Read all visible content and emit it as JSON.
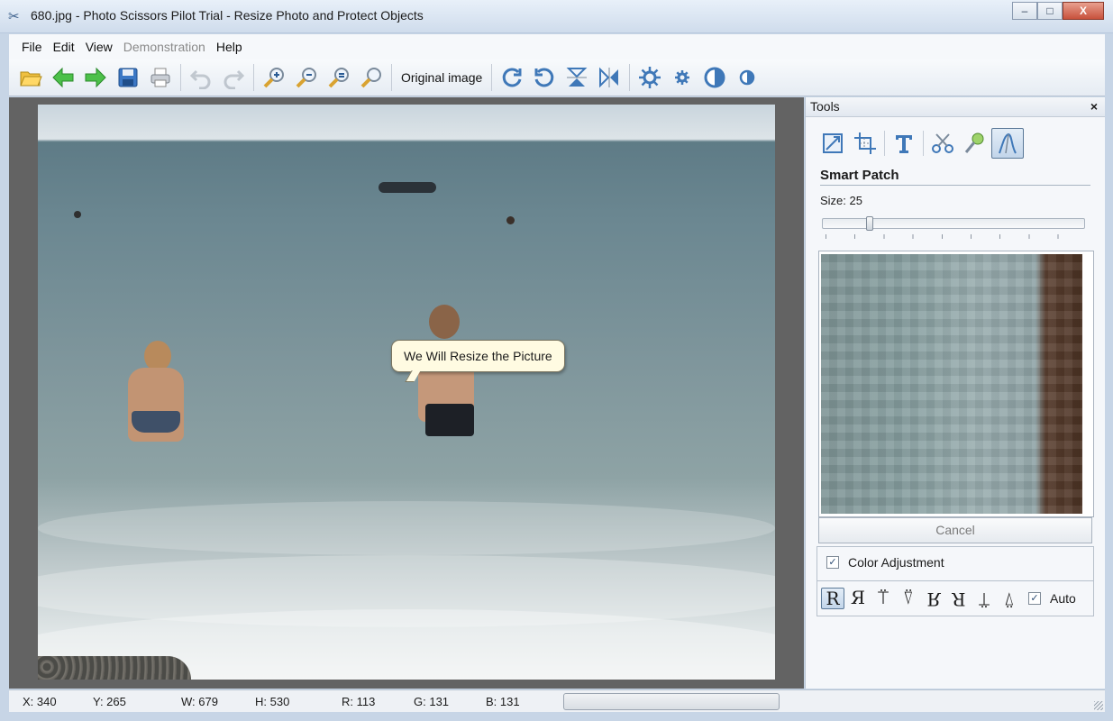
{
  "window": {
    "title": "680.jpg - Photo Scissors Pilot Trial - Resize Photo and Protect Objects",
    "minimize": "–",
    "maximize": "□",
    "close": "X"
  },
  "menu": [
    {
      "label": "File",
      "enabled": true
    },
    {
      "label": "Edit",
      "enabled": true
    },
    {
      "label": "View",
      "enabled": true
    },
    {
      "label": "Demonstration",
      "enabled": false
    },
    {
      "label": "Help",
      "enabled": true
    }
  ],
  "toolbar": {
    "icons": [
      "open-folder-icon",
      "back-arrow-icon",
      "forward-arrow-icon",
      "save-icon",
      "print-icon",
      "undo-icon",
      "redo-icon",
      "zoom-in-icon",
      "zoom-out-icon",
      "zoom-fit-icon",
      "zoom-actual-icon",
      "rotate-cw-icon",
      "rotate-ccw-icon",
      "flip-vertical-icon",
      "flip-horizontal-icon",
      "brightness-icon",
      "settings-icon",
      "contrast-icon",
      "half-contrast-icon"
    ],
    "original_image_label": "Original image"
  },
  "canvas": {
    "tooltip": "We Will Resize the Picture"
  },
  "tools_panel": {
    "title": "Tools",
    "close": "×",
    "tools": [
      "resize-icon",
      "crop-icon",
      "text-icon",
      "scissors-icon",
      "magic-wand-icon",
      "smart-patch-icon"
    ],
    "active_tool": "smart-patch-icon",
    "section_title": "Smart Patch",
    "size_label": "Size: 25",
    "size_value": 25,
    "cancel_label": "Cancel",
    "color_adjustment_label": "Color Adjustment",
    "color_adjustment_checked": true,
    "directions": [
      "R",
      "Я",
      "⍡",
      "⍢",
      "R",
      "R",
      "⍡",
      "⍢"
    ],
    "auto_label": "Auto",
    "auto_checked": true
  },
  "status": {
    "x": "X: 340",
    "y": "Y: 265",
    "w": "W: 679",
    "h": "H: 530",
    "r": "R: 113",
    "g": "G: 131",
    "b": "B: 131"
  }
}
